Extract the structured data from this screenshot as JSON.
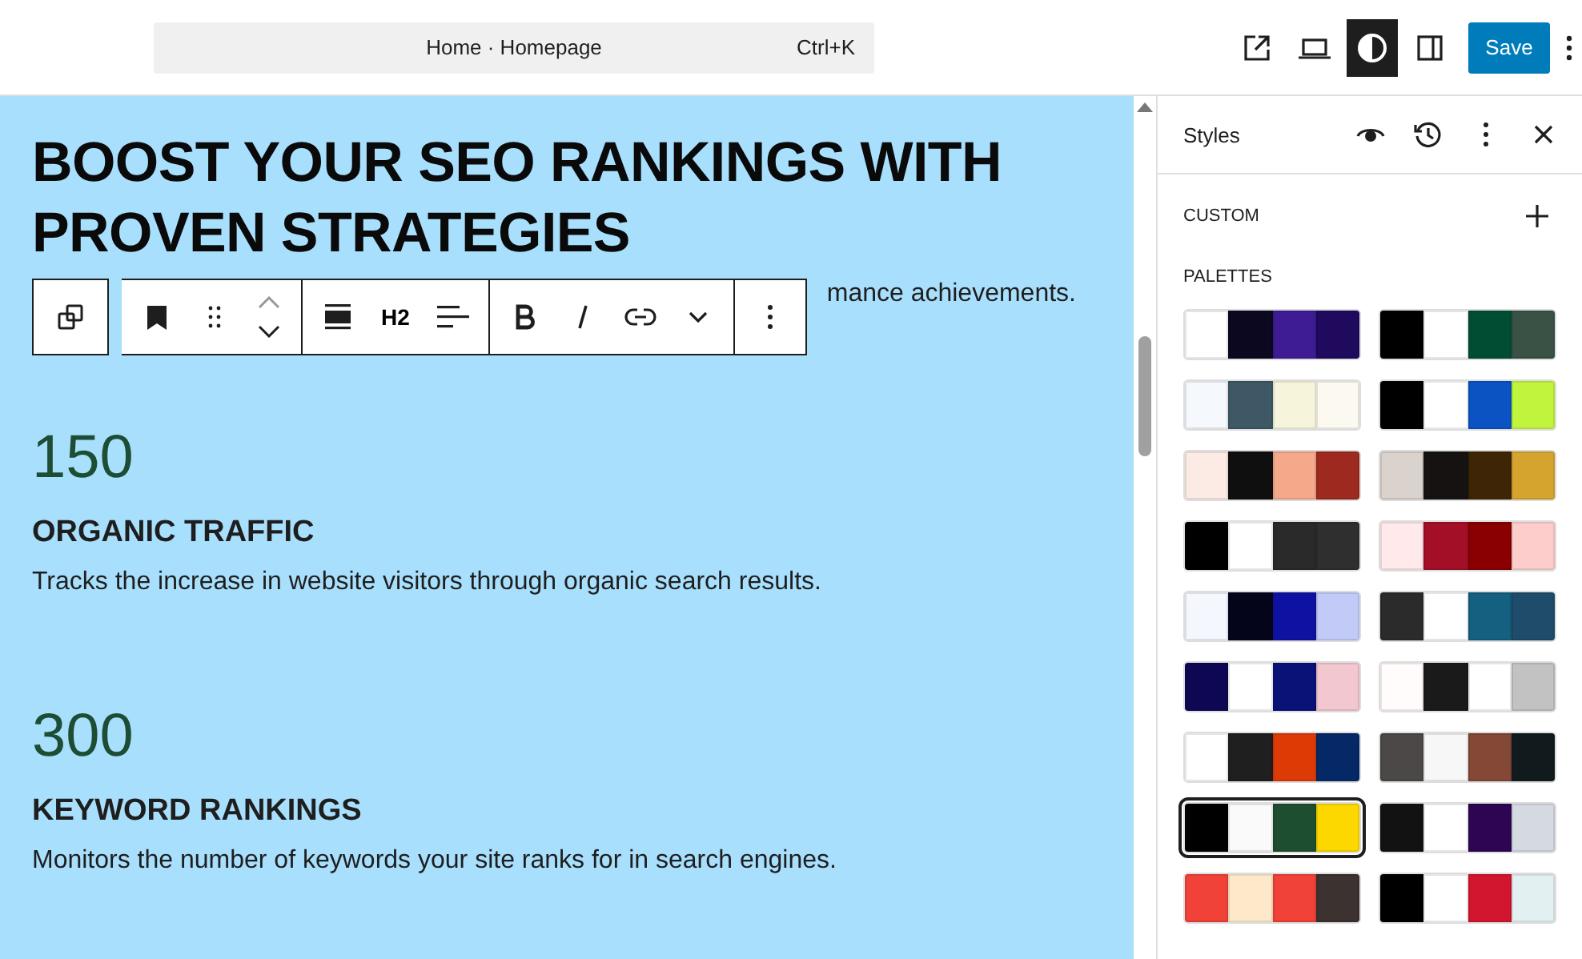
{
  "topbar": {
    "command": {
      "label": "Home · Homepage",
      "shortcut": "Ctrl+K"
    },
    "style_toggle_selected": true,
    "save": "Save"
  },
  "canvas": {
    "heading": "BOOST YOUR SEO RANKINGS WITH PROVEN STRATEGIES",
    "intro_visible": "mance achievements.",
    "toolbar": {
      "heading_level": "H2"
    },
    "stats": [
      {
        "number": "150",
        "title": "ORGANIC TRAFFIC",
        "text": "Tracks the increase in website visitors through organic search results."
      },
      {
        "number": "300",
        "title": "KEYWORD RANKINGS",
        "text": "Monitors the number of keywords your site ranks for in search engines."
      }
    ]
  },
  "sidebar": {
    "title": "Styles",
    "custom": "CUSTOM",
    "palettes_label": "PALETTES",
    "palettes": [
      {
        "swatches": [
          {
            "color": "#ffffff"
          },
          {
            "color": "#0b0820"
          },
          {
            "color": "#3d1c94"
          },
          {
            "color": "#1f0a5e"
          }
        ],
        "selected": false
      },
      {
        "swatches": [
          {
            "color": "#000000"
          },
          {
            "color": "#ffffff"
          },
          {
            "color": "#004d33"
          },
          {
            "color": "#3a5245"
          }
        ],
        "selected": false
      },
      {
        "swatches": [
          {
            "color": "#f5f8fc"
          },
          {
            "color": "#3f5866"
          },
          {
            "color": "#f7f4dc"
          },
          {
            "color": "#fcf9f0"
          }
        ],
        "selected": false
      },
      {
        "swatches": [
          {
            "color": "#000000"
          },
          {
            "color": "#ffffff"
          },
          {
            "color": "#0b53c3"
          },
          {
            "color": "#c1f53d"
          }
        ],
        "selected": false
      },
      {
        "swatches": [
          {
            "color": "#fcebe4"
          },
          {
            "color": "#0f0f0f"
          },
          {
            "color": "#f4a98a"
          },
          {
            "color": "#9e2a1f"
          }
        ],
        "selected": false
      },
      {
        "swatches": [
          {
            "color": "#d9d2cd"
          },
          {
            "color": "#161212"
          },
          {
            "color": "#3e2505"
          },
          {
            "color": "#d5a42f"
          }
        ],
        "selected": false
      },
      {
        "swatches": [
          {
            "color": "#000000"
          },
          {
            "color": "#ffffff"
          },
          {
            "color": "#2a2a2a"
          },
          {
            "color": "#2f2f2f"
          }
        ],
        "selected": false
      },
      {
        "swatches": [
          {
            "color": "#ffe9ea"
          },
          {
            "color": "#a30f26"
          },
          {
            "color": "#8a0000"
          },
          {
            "color": "#fdcdcb"
          }
        ],
        "selected": false
      },
      {
        "swatches": [
          {
            "color": "#f4f7fd"
          },
          {
            "color": "#04051a"
          },
          {
            "color": "#0e12a2"
          },
          {
            "color": "#c2cbf8"
          }
        ],
        "selected": false
      },
      {
        "swatches": [
          {
            "color": "#2b2b2b"
          },
          {
            "color": "#ffffff"
          },
          {
            "color": "#146080"
          },
          {
            "color": "#1f4c6b"
          }
        ],
        "selected": false
      },
      {
        "swatches": [
          {
            "color": "#0e0753"
          },
          {
            "color": "#ffffff"
          },
          {
            "color": "#0a1278"
          },
          {
            "color": "#f2c7d0"
          }
        ],
        "selected": false
      },
      {
        "swatches": [
          {
            "color": "#fffcfb"
          },
          {
            "color": "#1a1a1a"
          },
          {
            "color": "#ffffff"
          },
          {
            "color": "#c2c2c2"
          }
        ],
        "selected": false
      },
      {
        "swatches": [
          {
            "color": "#ffffff"
          },
          {
            "color": "#1f1f1f"
          },
          {
            "color": "#de3a06"
          },
          {
            "color": "#052866"
          }
        ],
        "selected": false
      },
      {
        "swatches": [
          {
            "color": "#4d4848"
          },
          {
            "color": "#f6f7f6"
          },
          {
            "color": "#834836"
          },
          {
            "color": "#111b1e"
          }
        ],
        "selected": false
      },
      {
        "swatches": [
          {
            "color": "#000000"
          },
          {
            "color": "#fafafa"
          },
          {
            "color": "#1d4e2f"
          },
          {
            "color": "#fdd800"
          }
        ],
        "selected": true
      },
      {
        "swatches": [
          {
            "color": "#121212"
          },
          {
            "color": "#ffffff"
          },
          {
            "color": "#2d0552"
          },
          {
            "color": "#d5d9e1"
          }
        ],
        "selected": false
      },
      {
        "swatches": [
          {
            "color": "#f04238"
          },
          {
            "color": "#fde9c9"
          },
          {
            "color": "#f04238"
          },
          {
            "color": "#3c3230"
          }
        ],
        "selected": false
      },
      {
        "swatches": [
          {
            "color": "#000000"
          },
          {
            "color": "#ffffff"
          },
          {
            "color": "#d3162f"
          },
          {
            "color": "#e3f0f2"
          }
        ],
        "selected": false
      }
    ]
  }
}
